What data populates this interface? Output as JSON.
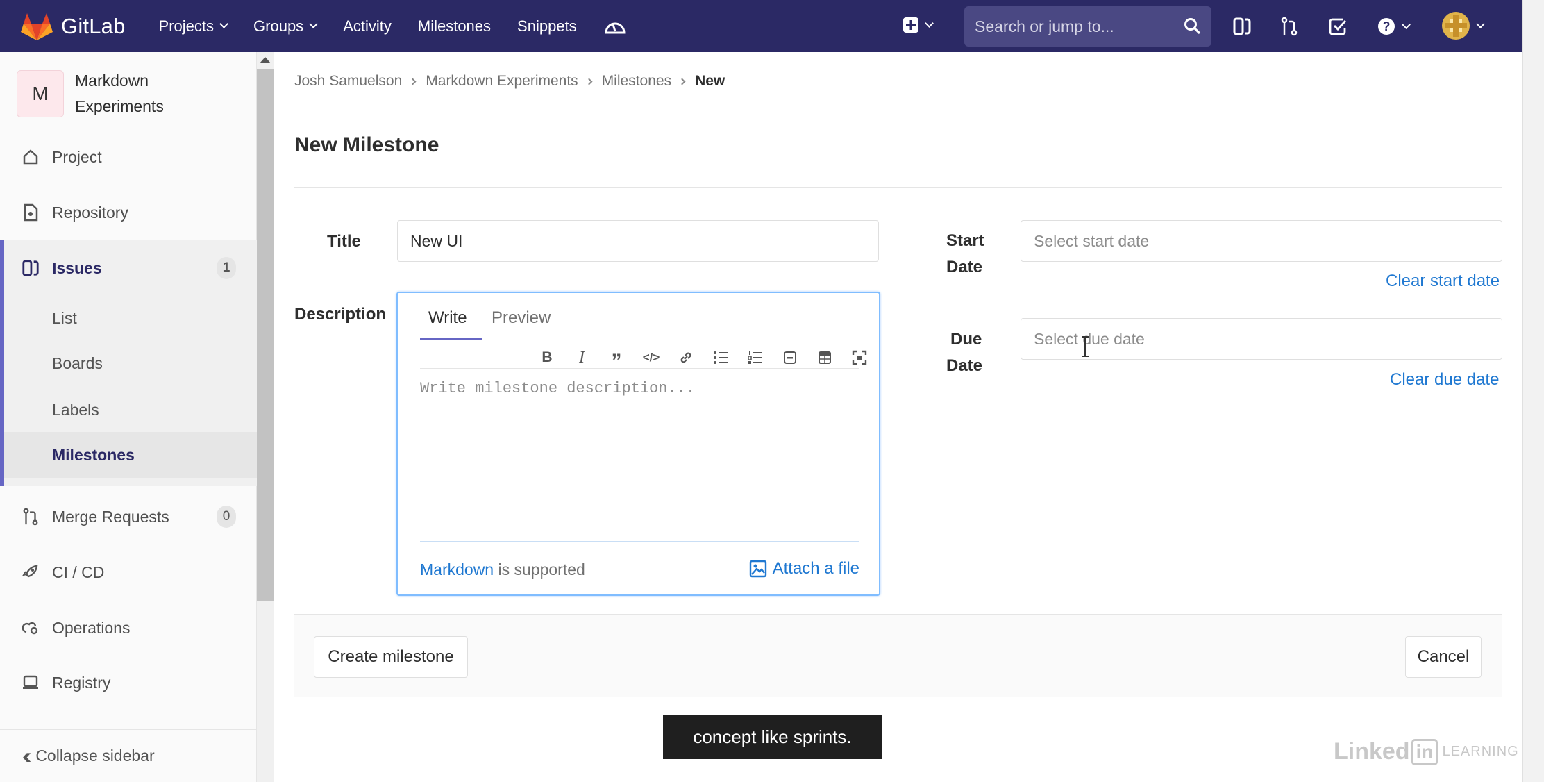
{
  "nav": {
    "brand": "GitLab",
    "links": [
      {
        "label": "Projects",
        "dropdown": true
      },
      {
        "label": "Groups",
        "dropdown": true
      },
      {
        "label": "Activity",
        "dropdown": false
      },
      {
        "label": "Milestones",
        "dropdown": false
      },
      {
        "label": "Snippets",
        "dropdown": false
      }
    ],
    "search_placeholder": "Search or jump to...",
    "icons": [
      "performance-icon",
      "plus-icon",
      "search-icon",
      "issues-icon",
      "merge-request-icon",
      "todo-icon",
      "help-icon",
      "user-avatar"
    ]
  },
  "sidebar": {
    "project_initial": "M",
    "project_name": "Markdown Experiments",
    "items": [
      {
        "label": "Project",
        "icon": "home-icon"
      },
      {
        "label": "Repository",
        "icon": "doc-icon"
      },
      {
        "label": "Issues",
        "icon": "issues-icon",
        "badge": "1"
      },
      {
        "label": "Merge Requests",
        "icon": "merge-request-icon",
        "badge": "0"
      },
      {
        "label": "CI / CD",
        "icon": "rocket-icon"
      },
      {
        "label": "Operations",
        "icon": "cloud-gear-icon"
      },
      {
        "label": "Registry",
        "icon": "container-icon"
      }
    ],
    "issues_sub": [
      "List",
      "Boards",
      "Labels",
      "Milestones"
    ],
    "collapse_label": "Collapse sidebar"
  },
  "breadcrumb": [
    "Josh Samuelson",
    "Markdown Experiments",
    "Milestones",
    "New"
  ],
  "page": {
    "title": "New Milestone",
    "title_label": "Title",
    "title_value": "New UI",
    "description_label": "Description",
    "tab_write": "Write",
    "tab_preview": "Preview",
    "description_placeholder": "Write milestone description...",
    "markdown_link": "Markdown",
    "markdown_suffix": " is supported",
    "attach_label": "Attach a file",
    "start_label_1": "Start",
    "start_label_2": "Date",
    "start_placeholder": "Select start date",
    "clear_start": "Clear start date",
    "due_label_1": "Due",
    "due_label_2": "Date",
    "due_placeholder": "Select due date",
    "clear_due": "Clear due date",
    "create_button": "Create milestone",
    "cancel_button": "Cancel"
  },
  "colors": {
    "nav_bg": "#2b2965",
    "link": "#1f78d1",
    "active_accent": "#6666c4"
  },
  "caption": "concept like sprints.",
  "watermark": {
    "linked": "Linked",
    "in": "in",
    "learning": "LEARNING"
  }
}
